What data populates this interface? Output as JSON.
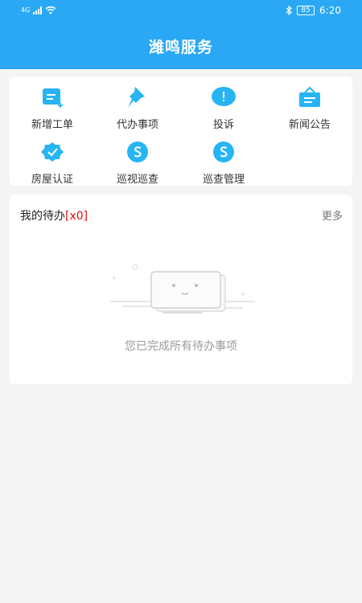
{
  "status": {
    "network": "4G",
    "time": "6:20",
    "battery": "85"
  },
  "header": {
    "title": "潍鸣服务"
  },
  "menu": {
    "items": [
      {
        "label": "新增工单",
        "icon": "new-ticket-icon"
      },
      {
        "label": "代办事项",
        "icon": "pin-icon"
      },
      {
        "label": "投诉",
        "icon": "exclamation-icon"
      },
      {
        "label": "新闻公告",
        "icon": "news-icon"
      },
      {
        "label": "房屋认证",
        "icon": "badge-check-icon"
      },
      {
        "label": "巡视巡查",
        "icon": "s-loop-icon"
      },
      {
        "label": "巡查管理",
        "icon": "s-loop-icon"
      }
    ]
  },
  "todo": {
    "title": "我的待办",
    "count": "[x0]",
    "more": "更多",
    "empty_text": "您已完成所有待办事项"
  },
  "colors": {
    "primary": "#2aa8f5",
    "icon": "#27b4f3",
    "count": "#dd1111"
  }
}
